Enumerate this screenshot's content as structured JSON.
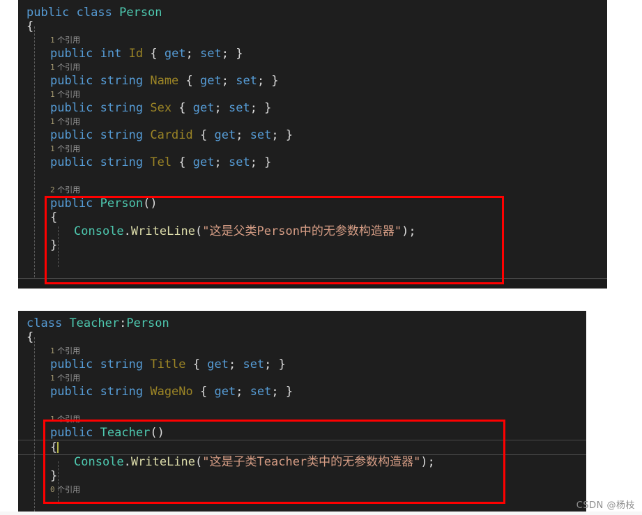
{
  "editor": {
    "theme": "dark",
    "background": "#1e1e1e",
    "colors": {
      "keyword": "#569cd6",
      "type": "#4ec9b0",
      "property": "#9c8526",
      "method": "#dcdcaa",
      "string": "#d69d85",
      "plain": "#dcdcdc",
      "codelens": "#9a9a9a",
      "annotation_box": "#fe0000",
      "page_background": "#ffffff"
    },
    "codelens_suffix": "个引用"
  },
  "panels": [
    {
      "id": "person",
      "name": "person-class-panel",
      "lines": [
        {
          "type": "code",
          "indent": 0,
          "tokens": [
            {
              "t": "kw",
              "v": "public"
            },
            {
              "t": "plain",
              "v": " "
            },
            {
              "t": "kw",
              "v": "class"
            },
            {
              "t": "plain",
              "v": " "
            },
            {
              "t": "typ",
              "v": "Person"
            }
          ]
        },
        {
          "type": "code",
          "indent": 0,
          "tokens": [
            {
              "t": "plain",
              "v": "{"
            }
          ]
        },
        {
          "type": "lens",
          "indent": 1,
          "count": "1",
          "label": "个引用"
        },
        {
          "type": "code",
          "indent": 1,
          "tokens": [
            {
              "t": "kw",
              "v": "public"
            },
            {
              "t": "plain",
              "v": " "
            },
            {
              "t": "kw",
              "v": "int"
            },
            {
              "t": "plain",
              "v": " "
            },
            {
              "t": "prop",
              "v": "Id"
            },
            {
              "t": "plain",
              "v": " { "
            },
            {
              "t": "kw",
              "v": "get"
            },
            {
              "t": "plain",
              "v": "; "
            },
            {
              "t": "kw",
              "v": "set"
            },
            {
              "t": "plain",
              "v": "; }"
            }
          ]
        },
        {
          "type": "lens",
          "indent": 1,
          "count": "1",
          "label": "个引用"
        },
        {
          "type": "code",
          "indent": 1,
          "tokens": [
            {
              "t": "kw",
              "v": "public"
            },
            {
              "t": "plain",
              "v": " "
            },
            {
              "t": "kw",
              "v": "string"
            },
            {
              "t": "plain",
              "v": " "
            },
            {
              "t": "prop",
              "v": "Name"
            },
            {
              "t": "plain",
              "v": " { "
            },
            {
              "t": "kw",
              "v": "get"
            },
            {
              "t": "plain",
              "v": "; "
            },
            {
              "t": "kw",
              "v": "set"
            },
            {
              "t": "plain",
              "v": "; }"
            }
          ]
        },
        {
          "type": "lens",
          "indent": 1,
          "count": "1",
          "label": "个引用"
        },
        {
          "type": "code",
          "indent": 1,
          "tokens": [
            {
              "t": "kw",
              "v": "public"
            },
            {
              "t": "plain",
              "v": " "
            },
            {
              "t": "kw",
              "v": "string"
            },
            {
              "t": "plain",
              "v": " "
            },
            {
              "t": "prop",
              "v": "Sex"
            },
            {
              "t": "plain",
              "v": " { "
            },
            {
              "t": "kw",
              "v": "get"
            },
            {
              "t": "plain",
              "v": "; "
            },
            {
              "t": "kw",
              "v": "set"
            },
            {
              "t": "plain",
              "v": "; }"
            }
          ]
        },
        {
          "type": "lens",
          "indent": 1,
          "count": "1",
          "label": "个引用"
        },
        {
          "type": "code",
          "indent": 1,
          "tokens": [
            {
              "t": "kw",
              "v": "public"
            },
            {
              "t": "plain",
              "v": " "
            },
            {
              "t": "kw",
              "v": "string"
            },
            {
              "t": "plain",
              "v": " "
            },
            {
              "t": "prop",
              "v": "Cardid"
            },
            {
              "t": "plain",
              "v": " { "
            },
            {
              "t": "kw",
              "v": "get"
            },
            {
              "t": "plain",
              "v": "; "
            },
            {
              "t": "kw",
              "v": "set"
            },
            {
              "t": "plain",
              "v": "; }"
            }
          ]
        },
        {
          "type": "lens",
          "indent": 1,
          "count": "1",
          "label": "个引用"
        },
        {
          "type": "code",
          "indent": 1,
          "tokens": [
            {
              "t": "kw",
              "v": "public"
            },
            {
              "t": "plain",
              "v": " "
            },
            {
              "t": "kw",
              "v": "string"
            },
            {
              "t": "plain",
              "v": " "
            },
            {
              "t": "prop",
              "v": "Tel"
            },
            {
              "t": "plain",
              "v": " { "
            },
            {
              "t": "kw",
              "v": "get"
            },
            {
              "t": "plain",
              "v": "; "
            },
            {
              "t": "kw",
              "v": "set"
            },
            {
              "t": "plain",
              "v": "; }"
            }
          ]
        },
        {
          "type": "blank"
        },
        {
          "type": "lens",
          "indent": 1,
          "count": "2",
          "label": "个引用"
        },
        {
          "type": "code",
          "indent": 1,
          "tokens": [
            {
              "t": "kw",
              "v": "public"
            },
            {
              "t": "plain",
              "v": " "
            },
            {
              "t": "typ",
              "v": "Person"
            },
            {
              "t": "plain",
              "v": "()"
            }
          ]
        },
        {
          "type": "code",
          "indent": 1,
          "tokens": [
            {
              "t": "plain",
              "v": "{"
            }
          ]
        },
        {
          "type": "code",
          "indent": 2,
          "tokens": [
            {
              "t": "typ",
              "v": "Console"
            },
            {
              "t": "plain",
              "v": "."
            },
            {
              "t": "meth",
              "v": "WriteLine"
            },
            {
              "t": "plain",
              "v": "("
            },
            {
              "t": "str",
              "v": "\"这是父类Person中的无参数构造器\""
            },
            {
              "t": "plain",
              "v": ");"
            }
          ]
        },
        {
          "type": "code",
          "indent": 1,
          "tokens": [
            {
              "t": "plain",
              "v": "}"
            }
          ]
        }
      ]
    },
    {
      "id": "teacher",
      "name": "teacher-class-panel",
      "lines": [
        {
          "type": "code",
          "indent": 0,
          "tokens": [
            {
              "t": "kw",
              "v": "class"
            },
            {
              "t": "plain",
              "v": " "
            },
            {
              "t": "typ",
              "v": "Teacher"
            },
            {
              "t": "plain",
              "v": ":"
            },
            {
              "t": "typ",
              "v": "Person"
            }
          ]
        },
        {
          "type": "code",
          "indent": 0,
          "tokens": [
            {
              "t": "plain",
              "v": "{"
            }
          ]
        },
        {
          "type": "lens",
          "indent": 1,
          "count": "1",
          "label": "个引用"
        },
        {
          "type": "code",
          "indent": 1,
          "tokens": [
            {
              "t": "kw",
              "v": "public"
            },
            {
              "t": "plain",
              "v": " "
            },
            {
              "t": "kw",
              "v": "string"
            },
            {
              "t": "plain",
              "v": " "
            },
            {
              "t": "prop",
              "v": "Title"
            },
            {
              "t": "plain",
              "v": " { "
            },
            {
              "t": "kw",
              "v": "get"
            },
            {
              "t": "plain",
              "v": "; "
            },
            {
              "t": "kw",
              "v": "set"
            },
            {
              "t": "plain",
              "v": "; }"
            }
          ]
        },
        {
          "type": "lens",
          "indent": 1,
          "count": "1",
          "label": "个引用"
        },
        {
          "type": "code",
          "indent": 1,
          "tokens": [
            {
              "t": "kw",
              "v": "public"
            },
            {
              "t": "plain",
              "v": " "
            },
            {
              "t": "kw",
              "v": "string"
            },
            {
              "t": "plain",
              "v": " "
            },
            {
              "t": "prop",
              "v": "WageNo"
            },
            {
              "t": "plain",
              "v": " { "
            },
            {
              "t": "kw",
              "v": "get"
            },
            {
              "t": "plain",
              "v": "; "
            },
            {
              "t": "kw",
              "v": "set"
            },
            {
              "t": "plain",
              "v": "; }"
            }
          ]
        },
        {
          "type": "blank"
        },
        {
          "type": "lens",
          "indent": 1,
          "count": "1",
          "label": "个引用"
        },
        {
          "type": "code",
          "indent": 1,
          "tokens": [
            {
              "t": "kw",
              "v": "public"
            },
            {
              "t": "plain",
              "v": " "
            },
            {
              "t": "typ",
              "v": "Teacher"
            },
            {
              "t": "plain",
              "v": "()"
            }
          ]
        },
        {
          "type": "code",
          "indent": 1,
          "current": true,
          "caret": true,
          "tokens": [
            {
              "t": "plain",
              "v": "{"
            }
          ]
        },
        {
          "type": "code",
          "indent": 2,
          "tokens": [
            {
              "t": "typ",
              "v": "Console"
            },
            {
              "t": "plain",
              "v": "."
            },
            {
              "t": "meth",
              "v": "WriteLine"
            },
            {
              "t": "plain",
              "v": "("
            },
            {
              "t": "str",
              "v": "\"这是子类Teacher类中的无参数构造器\""
            },
            {
              "t": "plain",
              "v": ");"
            }
          ]
        },
        {
          "type": "code",
          "indent": 1,
          "tokens": [
            {
              "t": "plain",
              "v": "}"
            }
          ]
        },
        {
          "type": "lens",
          "indent": 1,
          "count": "0",
          "label": "个引用"
        }
      ]
    }
  ],
  "annotations": [
    {
      "name": "person-constructor-highlight",
      "color": "#fe0000"
    },
    {
      "name": "teacher-constructor-highlight",
      "color": "#fe0000"
    }
  ],
  "watermark": {
    "text": "CSDN @杨枝"
  }
}
